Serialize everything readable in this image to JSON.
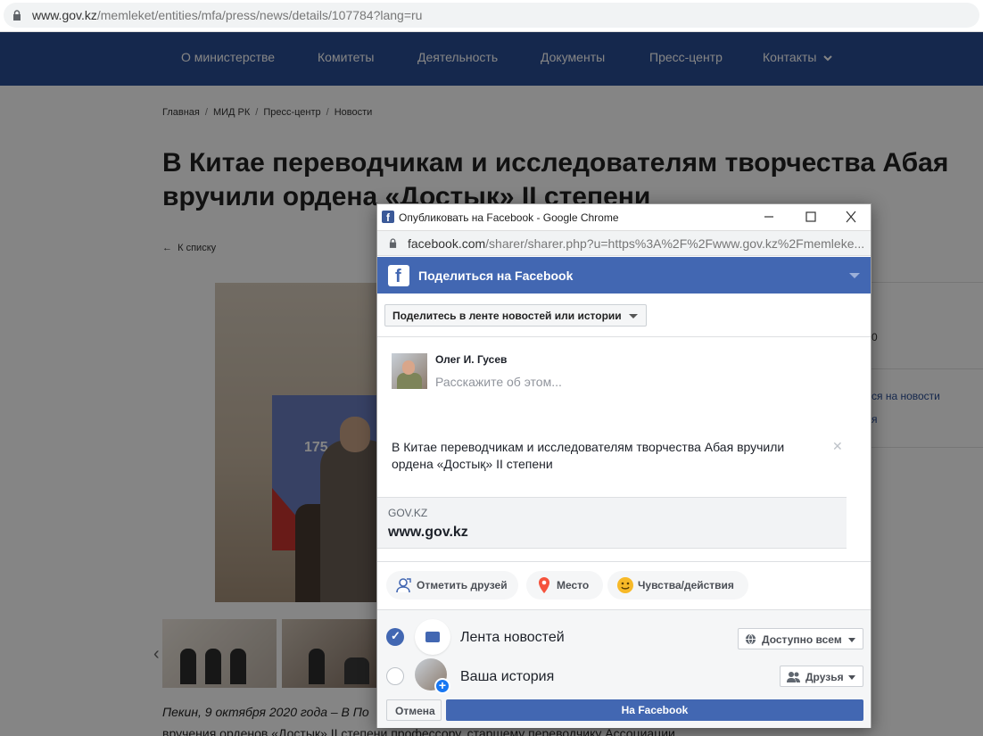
{
  "browser": {
    "url_host": "www.gov.kz",
    "url_path": "/memleket/entities/mfa/press/news/details/107784?lang=ru"
  },
  "nav": {
    "items": [
      "О министерстве",
      "Комитеты",
      "Деятельность",
      "Документы",
      "Пресс-центр",
      "Контакты"
    ],
    "dropdown_icon": "chevron-down-icon"
  },
  "breadcrumb": [
    "Главная",
    "МИД РК",
    "Пресс-центр",
    "Новости"
  ],
  "breadcrumb_sep": "/",
  "article": {
    "title": "В Китае переводчикам и исследователям творчества Абая вручили ордена «Достық» II степени",
    "back_label": "К списку",
    "banner_text": "175",
    "para1": "Пекин, 9 октября 2020 года – В По",
    "para2": "вручения орденов «Достық» II степени профессору, старшему переводчику Ассоциации"
  },
  "right_sidebar": {
    "fragment1": "0",
    "fragment2": "ся на новости",
    "fragment3": "я"
  },
  "popup": {
    "window_title": "Опубликовать на Facebook - Google Chrome",
    "url_host": "facebook.com",
    "url_path": "/sharer/sharer.php?u=https%3A%2F%2Fwww.gov.kz%2Fmemleke...",
    "header_title": "Поделиться на Facebook",
    "share_target": "Поделитесь в ленте новостей или истории",
    "user_name": "Олег И. Гусев",
    "composer_placeholder": "Расскажите об этом...",
    "quote_text": "В Китае переводчикам и исследователям творчества Абая вручили ордена «Достық» II степени",
    "link_domain": "GOV.KZ",
    "link_title": "www.gov.kz",
    "actions": [
      "Отметить друзей",
      "Место",
      "Чувства/действия"
    ],
    "audience": {
      "feed_label": "Лента новостей",
      "story_label": "Ваша история",
      "feed_privacy": "Доступно всем",
      "story_privacy": "Друзья"
    },
    "cancel_label": "Отмена",
    "post_label": "На Facebook"
  }
}
